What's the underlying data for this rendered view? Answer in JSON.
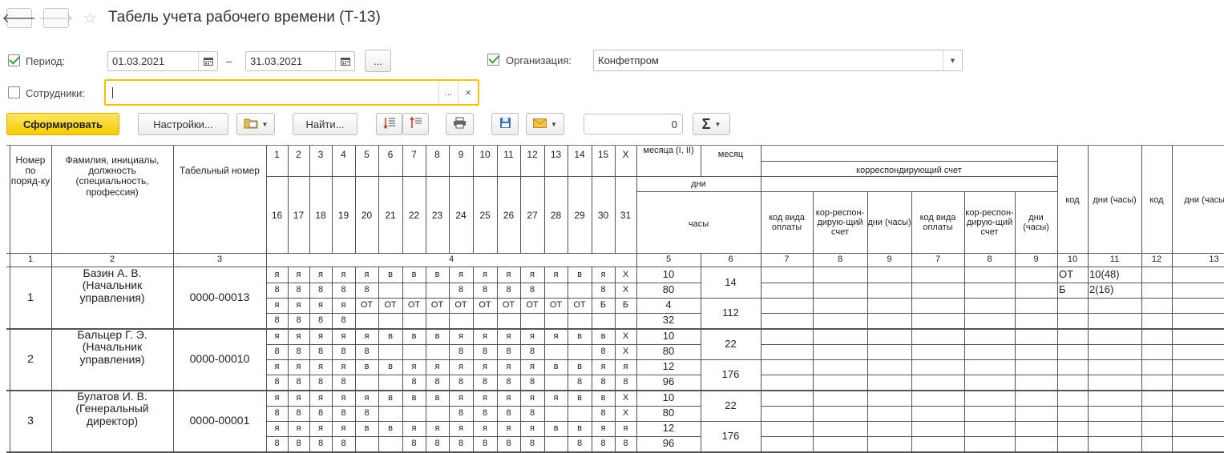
{
  "window": {
    "title": "Табель учета рабочего времени (Т-13)"
  },
  "nav": {
    "back_icon": "arrow-left-icon",
    "forward_icon": "arrow-right-icon",
    "back": "🡐",
    "forward": "🡒",
    "star": "☆"
  },
  "filters": {
    "period_label": "Период:",
    "period_checked": true,
    "date_from": "01.03.2021",
    "date_to": "31.03.2021",
    "dash": "–",
    "period_more": "...",
    "org_label": "Организация:",
    "org_checked": true,
    "org_value": "Конфетпром",
    "employees_label": "Сотрудники:",
    "employees_checked": false,
    "employees_value": "",
    "employees_more": "...",
    "employees_clear": "×"
  },
  "toolbar": {
    "generate": "Сформировать",
    "settings": "Настройки...",
    "find": "Найти...",
    "counter": "0",
    "sum_icon": "Σ"
  },
  "sheet": {
    "header": {
      "col1": "Номер по поряд-ку",
      "col2": "Фамилия, инициалы, должность (специальность, профессия)",
      "col3": "Табельный номер",
      "days_top": [
        "1",
        "2",
        "3",
        "4",
        "5",
        "6",
        "7",
        "8",
        "9",
        "10",
        "11",
        "12",
        "13",
        "14",
        "15",
        "X"
      ],
      "days_bottom": [
        "16",
        "17",
        "18",
        "19",
        "20",
        "21",
        "22",
        "23",
        "24",
        "25",
        "26",
        "27",
        "28",
        "29",
        "30",
        "31"
      ],
      "half_month": "месяца (I, II)",
      "month": "месяц",
      "days_label": "дни",
      "hours_label": "часы",
      "corr_account": "корреспондирующий счет",
      "pay_code": "код вида оплаты",
      "corr": "кор-респон-дирую-щий счет",
      "days_hours": "дни (часы)",
      "code": "код",
      "numbers": [
        "1",
        "2",
        "3",
        "4",
        "5",
        "6",
        "7",
        "8",
        "9",
        "7",
        "8",
        "9",
        "10",
        "11",
        "12",
        "13"
      ]
    },
    "employees": [
      {
        "num": "1",
        "name": "Базин А. В. (Начальник управления)",
        "tab": "0000-00013",
        "rows": [
          [
            "я",
            "я",
            "я",
            "я",
            "я",
            "в",
            "в",
            "в",
            "я",
            "я",
            "я",
            "я",
            "я",
            "в",
            "я",
            "Х"
          ],
          [
            "8",
            "8",
            "8",
            "8",
            "8",
            "",
            "",
            "",
            "8",
            "8",
            "8",
            "8",
            "",
            "",
            "8",
            "Х"
          ],
          [
            "я",
            "я",
            "я",
            "я",
            "ОТ",
            "ОТ",
            "ОТ",
            "ОТ",
            "ОТ",
            "ОТ",
            "ОТ",
            "ОТ",
            "ОТ",
            "ОТ",
            "Б",
            "Б"
          ],
          [
            "8",
            "8",
            "8",
            "8",
            "",
            "",
            "",
            "",
            "",
            "",
            "",
            "",
            "",
            "",
            "",
            ""
          ]
        ],
        "half": [
          "10",
          "80",
          "4",
          "32"
        ],
        "month": [
          "14",
          "112"
        ],
        "codes": [
          [
            "ОТ",
            "10(48)"
          ],
          [
            "Б",
            "2(16)"
          ]
        ]
      },
      {
        "num": "2",
        "name": "Бальцер Г. Э. (Начальник управления)",
        "tab": "0000-00010",
        "rows": [
          [
            "я",
            "я",
            "я",
            "я",
            "я",
            "в",
            "в",
            "в",
            "я",
            "я",
            "я",
            "я",
            "я",
            "в",
            "в",
            "Х"
          ],
          [
            "8",
            "8",
            "8",
            "8",
            "8",
            "",
            "",
            "",
            "8",
            "8",
            "8",
            "8",
            "",
            "",
            "8",
            "Х"
          ],
          [
            "я",
            "я",
            "я",
            "я",
            "в",
            "в",
            "я",
            "я",
            "я",
            "я",
            "я",
            "я",
            "в",
            "в",
            "я",
            "я"
          ],
          [
            "8",
            "8",
            "8",
            "8",
            "",
            "",
            "8",
            "8",
            "8",
            "8",
            "8",
            "8",
            "",
            "8",
            "8",
            "8"
          ]
        ],
        "half": [
          "10",
          "80",
          "12",
          "96"
        ],
        "month": [
          "22",
          "176"
        ],
        "codes": []
      },
      {
        "num": "3",
        "name": "Булатов И. В. (Генеральный директор)",
        "tab": "0000-00001",
        "rows": [
          [
            "я",
            "я",
            "я",
            "я",
            "я",
            "в",
            "в",
            "в",
            "я",
            "я",
            "я",
            "я",
            "я",
            "в",
            "в",
            "Х"
          ],
          [
            "8",
            "8",
            "8",
            "8",
            "8",
            "",
            "",
            "",
            "8",
            "8",
            "8",
            "8",
            "",
            "",
            "8",
            "Х"
          ],
          [
            "я",
            "я",
            "я",
            "я",
            "в",
            "в",
            "я",
            "я",
            "я",
            "я",
            "я",
            "я",
            "в",
            "в",
            "я",
            "я"
          ],
          [
            "8",
            "8",
            "8",
            "8",
            "",
            "",
            "8",
            "8",
            "8",
            "8",
            "8",
            "8",
            "",
            "8",
            "8",
            "8"
          ]
        ],
        "half": [
          "10",
          "80",
          "12",
          "96"
        ],
        "month": [
          "22",
          "176"
        ],
        "codes": []
      }
    ]
  }
}
